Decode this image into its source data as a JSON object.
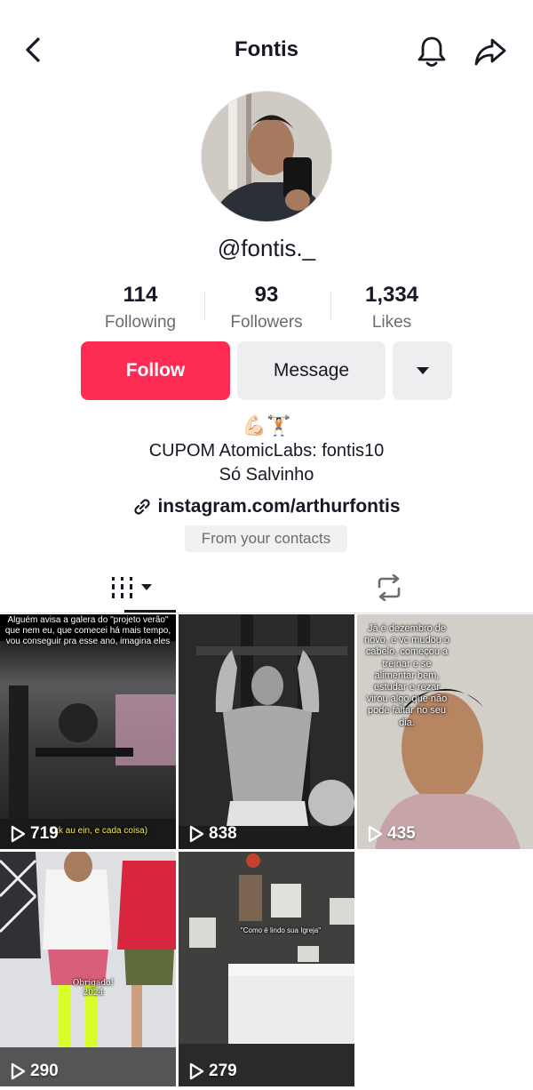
{
  "header": {
    "title": "Fontis"
  },
  "profile": {
    "username": "@fontis._",
    "stats": [
      {
        "value": "114",
        "label": "Following"
      },
      {
        "value": "93",
        "label": "Followers"
      },
      {
        "value": "1,334",
        "label": "Likes"
      }
    ],
    "buttons": {
      "follow": "Follow",
      "message": "Message"
    },
    "bio": {
      "emoji": "💪🏻🏋🏻",
      "line1": "CUPOM AtomicLabs: fontis10",
      "line2": "Só Salvinho"
    },
    "link": "instagram.com/arthurfontis",
    "contacts_badge": "From your contacts"
  },
  "videos": [
    {
      "views": "719",
      "caption": "Alguém avisa a galera do \"projeto verão\" que nem eu, que comecei há mais tempo, vou conseguir pra esse ano, imagina eles",
      "caption_bottom": "kkk au ein, e cada coisa)"
    },
    {
      "views": "838"
    },
    {
      "views": "435",
      "caption": "Já é dezembro de novo, e vc mudou o cabelo, começou a treinar e se alimentar bem, estudar e rezar virou algo que não pode faltar no seu dia."
    },
    {
      "views": "290",
      "caption": "Obrigado! 2024"
    },
    {
      "views": "279",
      "caption": "\"Como é lindo sua Igreja\""
    }
  ],
  "colors": {
    "accent": "#fe2c55",
    "text": "#161823",
    "secondary": "#6b6c72",
    "button_bg": "#eeeef0"
  }
}
